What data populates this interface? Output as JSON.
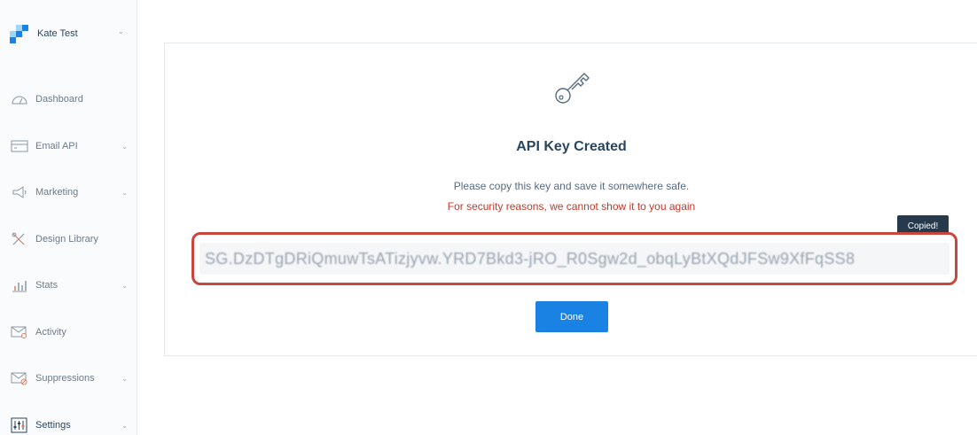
{
  "account": {
    "name": "Kate Test"
  },
  "sidebar": {
    "items": [
      {
        "label": "Dashboard",
        "icon": "dashboard-icon"
      },
      {
        "label": "Email API",
        "icon": "email-api-icon"
      },
      {
        "label": "Marketing",
        "icon": "megaphone-icon"
      },
      {
        "label": "Design Library",
        "icon": "design-library-icon"
      },
      {
        "label": "Stats",
        "icon": "stats-icon"
      },
      {
        "label": "Activity",
        "icon": "activity-icon"
      },
      {
        "label": "Suppressions",
        "icon": "suppressions-icon"
      },
      {
        "label": "Settings",
        "icon": "settings-icon"
      }
    ]
  },
  "modal": {
    "title": "API Key Created",
    "description": "Please copy this key and save it somewhere safe.",
    "warning": "For security reasons, we cannot show it to you again",
    "tooltip": "Copied!",
    "api_key": "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",
    "done_label": "Done"
  },
  "colors": {
    "accent": "#1a82e2",
    "warning": "#c0392b",
    "highlight_border": "#c9463d",
    "tooltip_bg": "#263a4b",
    "heading": "#294661"
  }
}
